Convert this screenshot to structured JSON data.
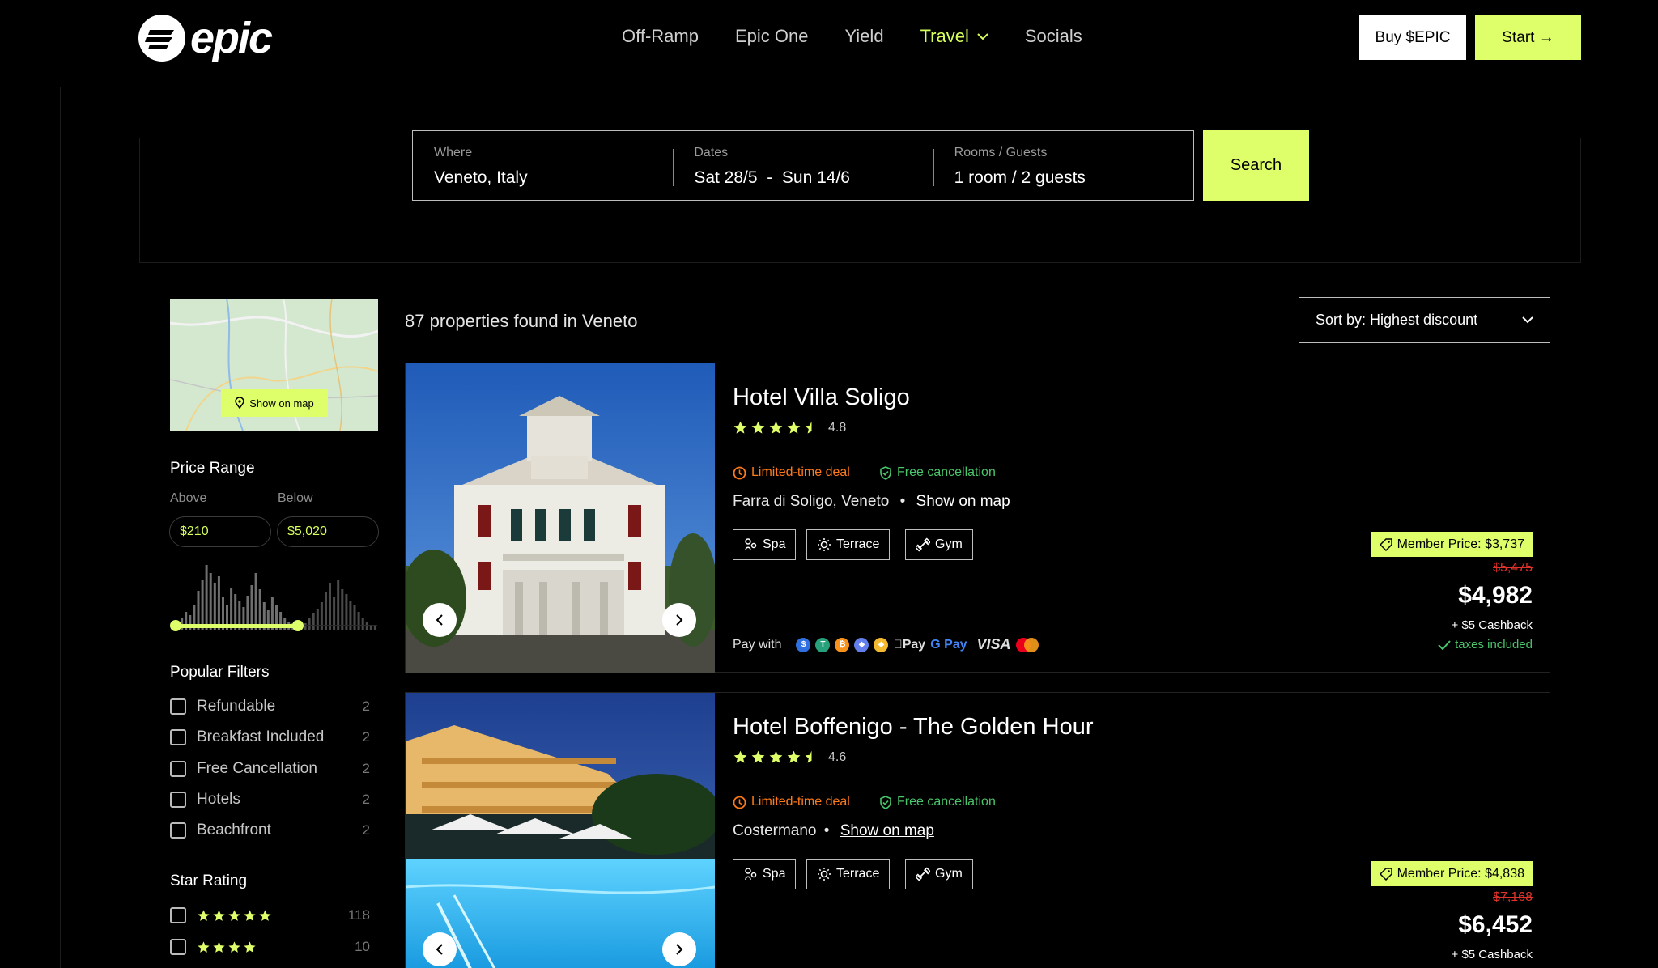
{
  "header": {
    "brand": "epic",
    "nav": [
      {
        "label": "Off-Ramp"
      },
      {
        "label": "Epic One"
      },
      {
        "label": "Yield"
      },
      {
        "label": "Travel"
      },
      {
        "label": "Socials"
      }
    ],
    "buy_label": "Buy $EPIC",
    "start_label": "Start →"
  },
  "search": {
    "where_label": "Where",
    "where_value": "Veneto, Italy",
    "dates_label": "Dates",
    "dates_value": "Sat 28/5  -  Sun 14/6",
    "rooms_label": "Rooms / Guests",
    "rooms_value": "1 room / 2 guests",
    "button": "Search"
  },
  "sidebar": {
    "map_button": "Show on map",
    "price_range_title": "Price Range",
    "above_label": "Above",
    "below_label": "Below",
    "above_value": "$210",
    "below_value": "$5,020",
    "popular_title": "Popular Filters",
    "filters": [
      {
        "label": "Refundable",
        "count": "2"
      },
      {
        "label": "Breakfast Included",
        "count": "2"
      },
      {
        "label": "Free Cancellation",
        "count": "2"
      },
      {
        "label": "Hotels",
        "count": "2"
      },
      {
        "label": "Beachfront",
        "count": "2"
      }
    ],
    "star_title": "Star Rating",
    "star_filters": [
      {
        "stars": 5,
        "count": "118"
      },
      {
        "stars": 4,
        "count": "10"
      }
    ]
  },
  "results": {
    "count_text": "87 properties found in Veneto",
    "sort_label": "Sort by: Highest discount",
    "hotels": [
      {
        "name": "Hotel Villa Soligo",
        "rating": "4.8",
        "deal": "Limited-time deal",
        "free_cancel": "Free cancellation",
        "location": "Farra di Soligo, Veneto",
        "separator": "•",
        "map_link": "Show on map",
        "amenities": [
          "Spa",
          "Terrace",
          "Gym"
        ],
        "pay_with": "Pay with",
        "member_price": "Member Price: $3,737",
        "old_price": "$5,475",
        "price": "$4,982",
        "cashback": "+ $5 Cashback",
        "taxes": "taxes included"
      },
      {
        "name": "Hotel Boffenigo - The Golden Hour",
        "rating": "4.6",
        "deal": "Limited-time deal",
        "free_cancel": "Free cancellation",
        "location": "Costermano",
        "separator": "•",
        "map_link": "Show on map",
        "amenities": [
          "Spa",
          "Terrace",
          "Gym"
        ],
        "member_price": "Member Price: $4,838",
        "old_price": "$7,168",
        "price": "$6,452",
        "cashback": "+ $5 Cashback"
      }
    ]
  },
  "colors": {
    "accent": "#dfff6a",
    "deal": "#ff7a1a",
    "free": "#49c66b",
    "strike": "#e0322a"
  },
  "payment_methods": [
    "Pay",
    "G Pay",
    "VISA"
  ]
}
